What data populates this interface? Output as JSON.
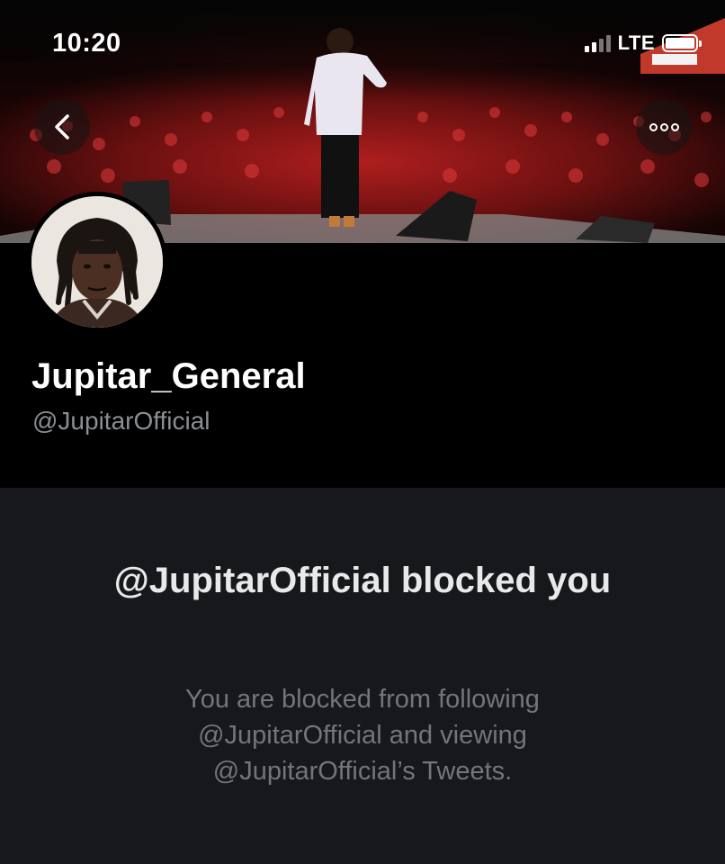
{
  "status_bar": {
    "time": "10:20",
    "network": "LTE"
  },
  "header": {
    "back_icon": "chevron-left-icon",
    "more_icon": "more-horizontal-icon"
  },
  "profile": {
    "display_name": "Jupitar_General",
    "handle": "@JupitarOfficial"
  },
  "blocked_notice": {
    "title": "@JupitarOfficial blocked you",
    "message": "You are blocked from following @JupitarOfficial and viewing @JupitarOfficial’s Tweets."
  },
  "colors": {
    "background": "#000000",
    "notice_background": "#17181c",
    "title_text": "#e7e9ea",
    "secondary_text": "#71767b",
    "banner_accent": "#c0392b"
  }
}
